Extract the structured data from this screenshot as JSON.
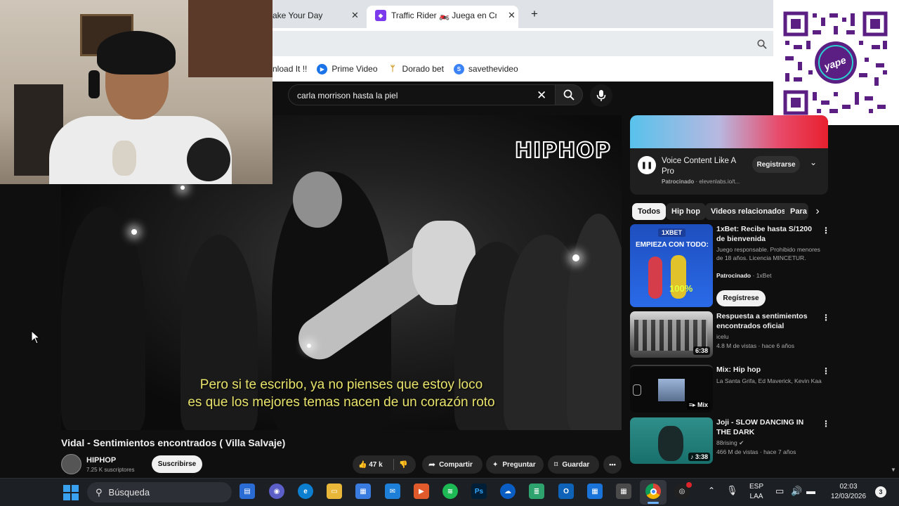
{
  "browser": {
    "tabs": [
      {
        "label": "ake Your Day"
      },
      {
        "label": "Traffic Rider 🏍️ Juega en Crazy"
      }
    ],
    "new_tab_label": "+",
    "bookmarks": [
      {
        "label": "nload It !!",
        "icon": "bookmark-icon"
      },
      {
        "label": "Prime Video",
        "icon": "prime-video-icon"
      },
      {
        "label": "Dorado bet",
        "icon": "dorado-bet-icon"
      },
      {
        "label": "savethevideo",
        "icon": "savethevideo-icon"
      }
    ]
  },
  "youtube": {
    "search": {
      "query": "carla morrison hasta la piel"
    },
    "player": {
      "watermark": "HIPHOP",
      "subtitle_line1": "Pero si te escribo, ya no pienses que estoy loco",
      "subtitle_line2": "es que los mejores temas nacen de un corazón roto"
    },
    "video": {
      "title": "Vidal - Sentimientos encontrados ( Villa Salvaje)",
      "channel": "HIPHOP",
      "subscribers": "7.25 K suscriptores",
      "subscribe_label": "Suscribirse",
      "likes": "47 k",
      "share_label": "Compartir",
      "ask_label": "Preguntar",
      "save_label": "Guardar",
      "more_label": "•••"
    },
    "ad": {
      "title": "Voice Content Like A Pro",
      "sponsored": "Patrocinado",
      "domain": "· elevenlabs.io/t...",
      "cta": "Registrarse"
    },
    "chips": [
      "Todos",
      "Hip hop",
      "Videos relacionados",
      "Para"
    ],
    "recommendations": [
      {
        "title": "1xBet: Recibe hasta S/1200 de bienvenida",
        "meta1": "Juego responsable. Prohibido menores de 18 años. Licencia MINCETUR.",
        "sponsored": "Patrocinado",
        "sponsor": "· 1xBet",
        "cta": "Regístrese",
        "thumb_brand": "1XBET",
        "thumb_text": "EMPIEZA CON TODO:",
        "thumb_percent": "100%"
      },
      {
        "title": "Respuesta a sentimientos encontrados oficial",
        "channel": "icelu",
        "meta": "4.8 M de vistas · hace 6 años",
        "duration": "6:38"
      },
      {
        "title": "Mix: Hip hop",
        "channel": "La Santa Grifa, Ed Maverick, Kevin Kaarl ...",
        "duration": "Mix"
      },
      {
        "title": "Joji - SLOW DANCING IN THE DARK",
        "channel": "88rising",
        "meta": "466 M de vistas · hace 7 años",
        "duration": "3:38"
      }
    ]
  },
  "taskbar": {
    "search_label": "Búsqueda",
    "lang_top": "ESP",
    "lang_bottom": "LAA",
    "time": "02:03",
    "date": "12/03/2026",
    "notifications": "3"
  },
  "overlay": {
    "qr_brand": "yape"
  }
}
